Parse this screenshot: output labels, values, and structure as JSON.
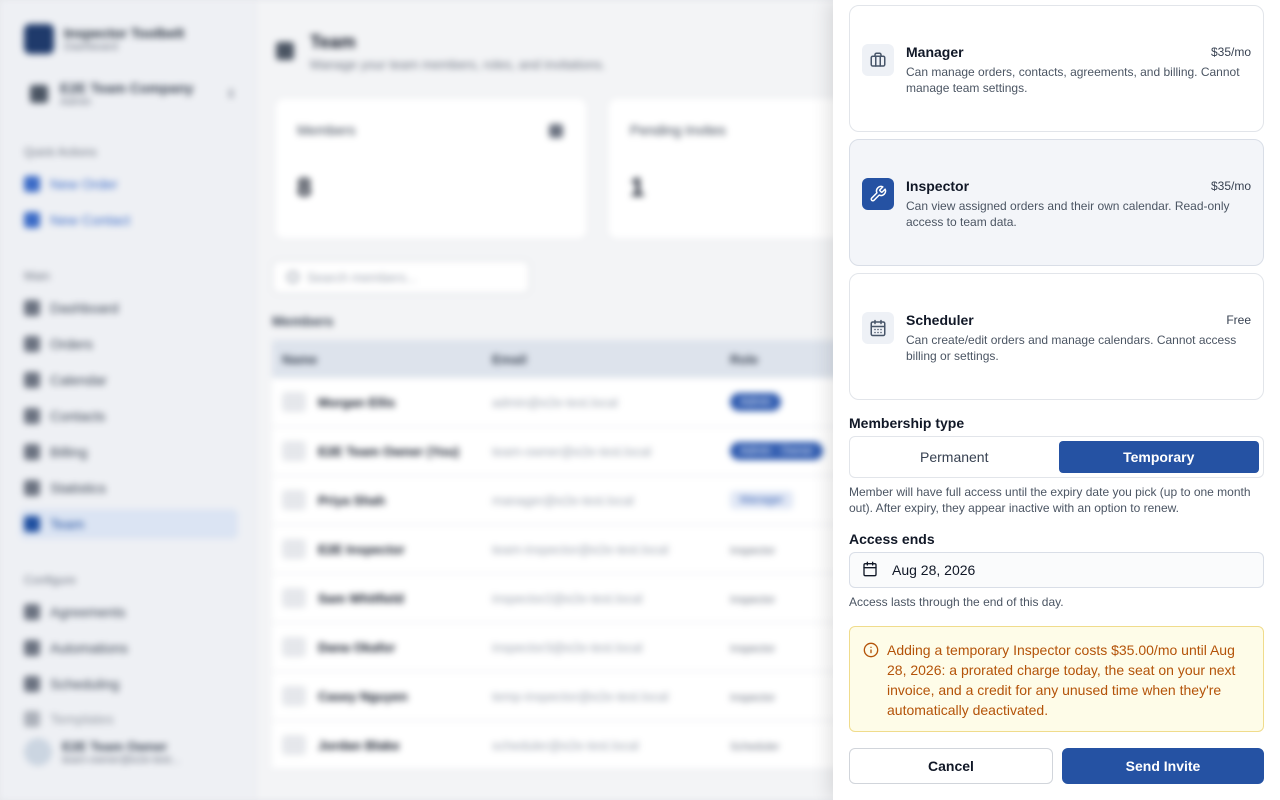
{
  "background": {
    "brand": {
      "name": "Inspector Toolbelt",
      "sub": "Dashboard"
    },
    "company": {
      "name": "E2E Team Company",
      "sub": "Admin"
    },
    "sections": {
      "quick": "Quick Actions",
      "main": "Main",
      "configure": "Configure"
    },
    "quick_actions": [
      "New Order",
      "New Contact"
    ],
    "main_nav": [
      "Dashboard",
      "Orders",
      "Calendar",
      "Contacts",
      "Billing",
      "Statistics",
      "Team"
    ],
    "configure_nav": [
      "Agreements",
      "Automations",
      "Scheduling",
      "Templates"
    ],
    "user": {
      "name": "E2E Team Owner",
      "email": "team-owner@e2e-test..."
    },
    "page": {
      "title": "Team",
      "subtitle": "Manage your team members, roles, and invitations."
    },
    "stats": [
      {
        "label": "Members",
        "value": "8"
      },
      {
        "label": "Pending Invites",
        "value": "1"
      }
    ],
    "search_placeholder": "Search members...",
    "members_title": "Members",
    "table_headers": [
      "Name",
      "Email",
      "Role"
    ],
    "rows": [
      {
        "name": "Morgan Ellis",
        "email": "admin@e2e-test.local",
        "role": "Admin",
        "style": "owner"
      },
      {
        "name": "E2E Team Owner (You)",
        "email": "team-owner@e2e-test.local",
        "role": "Admin · Owner",
        "style": "owner"
      },
      {
        "name": "Priya Shah",
        "email": "manager@e2e-test.local",
        "role": "Manager",
        "style": "mgr"
      },
      {
        "name": "E2E Inspector",
        "email": "team-inspector@e2e-test.local",
        "role": "Inspector",
        "style": "plain"
      },
      {
        "name": "Sam Whitfield",
        "email": "inspector2@e2e-test.local",
        "role": "Inspector",
        "style": "plain"
      },
      {
        "name": "Dana Okafor",
        "email": "inspector3@e2e-test.local",
        "role": "Inspector",
        "style": "plain"
      },
      {
        "name": "Casey Nguyen",
        "email": "temp-inspector@e2e-test.local",
        "role": "Inspector",
        "style": "plain"
      },
      {
        "name": "Jordan Blake",
        "email": "scheduler@e2e-test.local",
        "role": "Scheduler",
        "style": "plain"
      }
    ]
  },
  "drawer": {
    "roles": [
      {
        "name": "Manager",
        "price": "$35/mo",
        "desc": "Can manage orders, contacts, agreements, and billing. Cannot manage team settings.",
        "icon": "briefcase-icon",
        "selected": false
      },
      {
        "name": "Inspector",
        "price": "$35/mo",
        "desc": "Can view assigned orders and their own calendar. Read-only access to team data.",
        "icon": "wrench-icon",
        "selected": true
      },
      {
        "name": "Scheduler",
        "price": "Free",
        "desc": "Can create/edit orders and manage calendars. Cannot access billing or settings.",
        "icon": "calendar-icon",
        "selected": false
      }
    ],
    "membership_label": "Membership type",
    "membership_options": {
      "permanent": "Permanent",
      "temporary": "Temporary"
    },
    "membership_selected": "temporary",
    "membership_help": "Member will have full access until the expiry date you pick (up to one month out). After expiry, they appear inactive with an option to renew.",
    "access_label": "Access ends",
    "access_date": "Aug 28, 2026",
    "access_help": "Access lasts through the end of this day.",
    "notice": "Adding a temporary Inspector costs $35.00/mo until Aug 28, 2026: a prorated charge today, the seat on your next invoice, and a credit for any unused time when they're automatically deactivated.",
    "cancel_label": "Cancel",
    "send_label": "Send Invite",
    "colors": {
      "accent": "#2552a3",
      "notice_bg": "#fefce8",
      "notice_text": "#b45309"
    }
  }
}
